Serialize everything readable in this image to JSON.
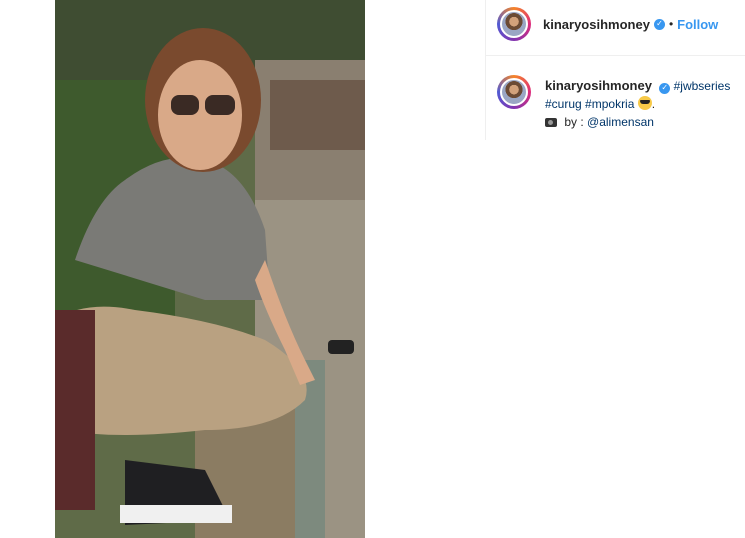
{
  "post": {
    "photo_icon": "photo",
    "author": "kinaryosihmoney",
    "verified_icon": "verified-badge-icon",
    "separator": "•",
    "follow_label": "Follow"
  },
  "caption": {
    "username": "kinaryosihmoney",
    "tags": [
      "#jwbseries",
      "#curug",
      "#mpokria"
    ],
    "credit_prefix": "by :",
    "credit_handle": "@alimensan",
    "emoji_icon": "sunglasses-emoji-icon",
    "camera_icon": "camera-emoji-icon"
  },
  "colors": {
    "link": "#3897f0",
    "hashtag": "#003569",
    "text": "#262626"
  }
}
